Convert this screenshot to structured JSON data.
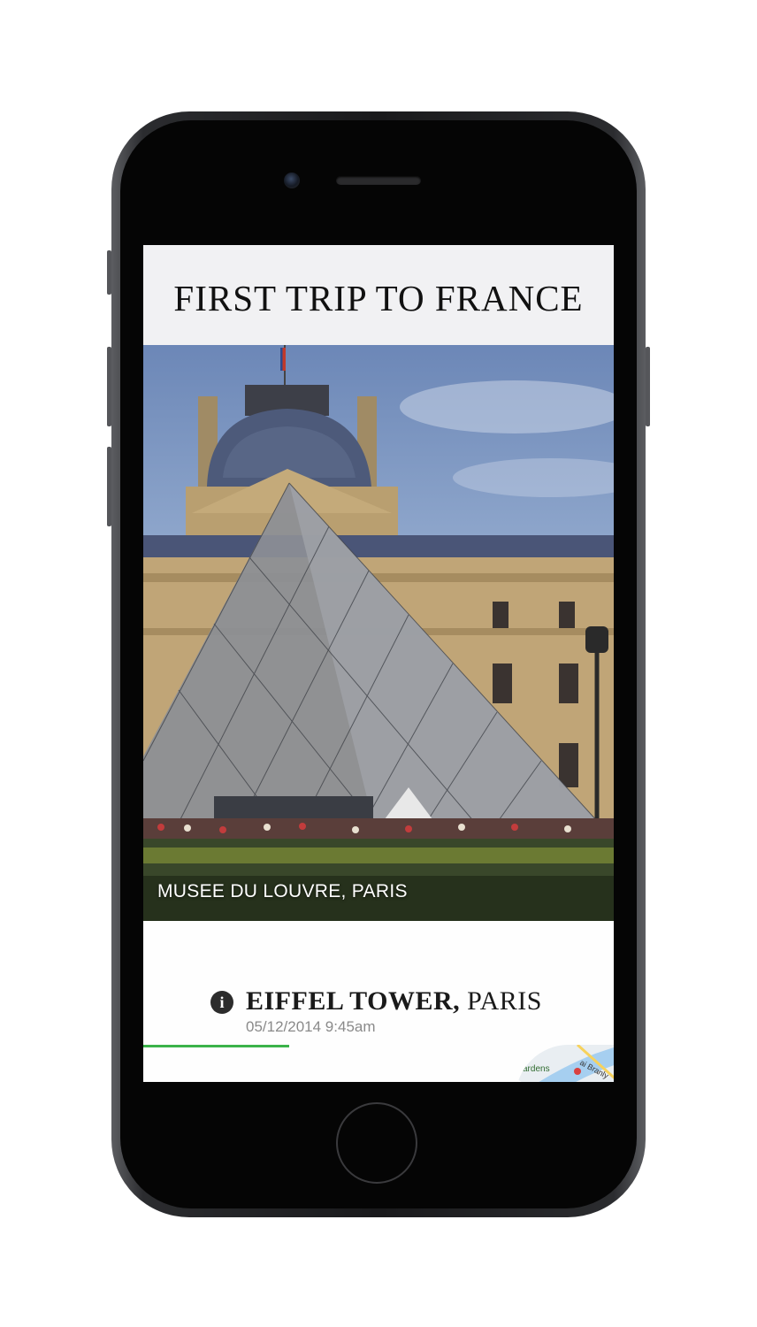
{
  "app": {
    "title": "FIRST TRIP TO FRANCE"
  },
  "hero": {
    "caption": "MUSEE DU LOUVRE, PARIS"
  },
  "entry": {
    "name_main": "EIFFEL TOWER,",
    "name_city": "PARIS",
    "timestamp": "05/12/2014 9:45am",
    "progress": 0.31,
    "map_label_1": "ardens",
    "map_label_2": "ai Branly",
    "icon": "info-icon"
  },
  "colors": {
    "progress": "#3bb34a",
    "header_bg": "#f1f1f3",
    "phone_body": "#1a1a1c"
  }
}
